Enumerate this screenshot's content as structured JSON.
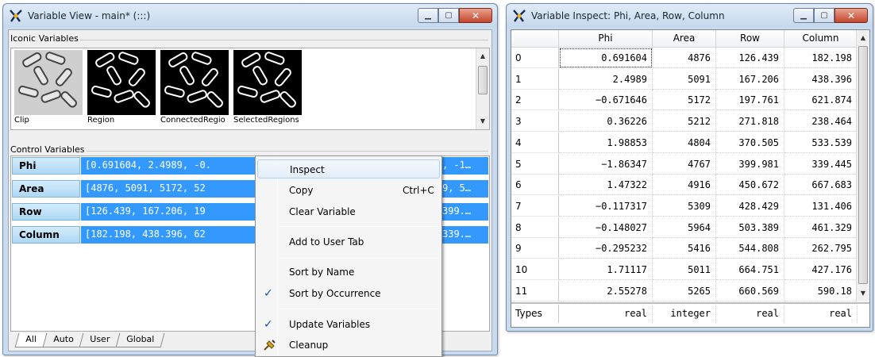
{
  "variable_view": {
    "title": "Variable View - main* (:::)",
    "iconic_label": "Iconic Variables",
    "iconic_items": [
      "Clip",
      "Region",
      "ConnectedRegions",
      "SelectedRegions"
    ],
    "control_label": "Control Variables",
    "controls": [
      {
        "name": "Phi",
        "value": "[0.691604, 2.4989, -0.",
        "tail": ", -1…"
      },
      {
        "name": "Area",
        "value": "[4876, 5091, 5172, 52",
        "tail": "9, 5…"
      },
      {
        "name": "Row",
        "value": "[126.439, 167.206, 19",
        "tail": "399.…"
      },
      {
        "name": "Column",
        "value": "[182.198, 438.396, 62",
        "tail": "339.…"
      }
    ],
    "tabs": [
      "All",
      "Auto",
      "User",
      "Global"
    ]
  },
  "context_menu": {
    "items": [
      {
        "label": "Inspect",
        "shortcut": "",
        "checked": false
      },
      {
        "label": "Copy",
        "shortcut": "Ctrl+C",
        "checked": false
      },
      {
        "label": "Clear Variable",
        "shortcut": "",
        "checked": false
      },
      {
        "label": "Add to User Tab",
        "shortcut": "",
        "checked": false
      },
      {
        "label": "Sort by Name",
        "shortcut": "",
        "checked": false
      },
      {
        "label": "Sort by Occurrence",
        "shortcut": "",
        "checked": true
      },
      {
        "label": "Update Variables",
        "shortcut": "",
        "checked": true
      },
      {
        "label": "Cleanup",
        "shortcut": "",
        "checked": false
      }
    ],
    "check_glyph": "✓"
  },
  "inspect_window": {
    "title": "Variable Inspect: Phi, Area, Row, Column",
    "columns": [
      "Phi",
      "Area",
      "Row",
      "Column"
    ],
    "rows": [
      {
        "idx": "0",
        "cells": [
          "0.691604",
          "4876",
          "126.439",
          "182.198"
        ]
      },
      {
        "idx": "1",
        "cells": [
          "2.4989",
          "5091",
          "167.206",
          "438.396"
        ]
      },
      {
        "idx": "2",
        "cells": [
          "−0.671646",
          "5172",
          "197.761",
          "621.874"
        ]
      },
      {
        "idx": "3",
        "cells": [
          "0.36226",
          "5212",
          "271.818",
          "238.464"
        ]
      },
      {
        "idx": "4",
        "cells": [
          "1.98853",
          "4804",
          "370.505",
          "533.539"
        ]
      },
      {
        "idx": "5",
        "cells": [
          "−1.86347",
          "4767",
          "399.981",
          "339.445"
        ]
      },
      {
        "idx": "6",
        "cells": [
          "1.47322",
          "4916",
          "450.672",
          "667.683"
        ]
      },
      {
        "idx": "7",
        "cells": [
          "−0.117317",
          "5309",
          "428.429",
          "131.406"
        ]
      },
      {
        "idx": "8",
        "cells": [
          "−0.148027",
          "5964",
          "503.389",
          "461.329"
        ]
      },
      {
        "idx": "9",
        "cells": [
          "−0.295232",
          "5416",
          "544.808",
          "262.795"
        ]
      },
      {
        "idx": "10",
        "cells": [
          "1.71117",
          "5011",
          "664.751",
          "427.176"
        ]
      },
      {
        "idx": "11",
        "cells": [
          "2.55278",
          "5265",
          "660.569",
          "590.18"
        ]
      }
    ],
    "types_label": "Types",
    "types": [
      "real",
      "integer",
      "real",
      "real"
    ]
  }
}
